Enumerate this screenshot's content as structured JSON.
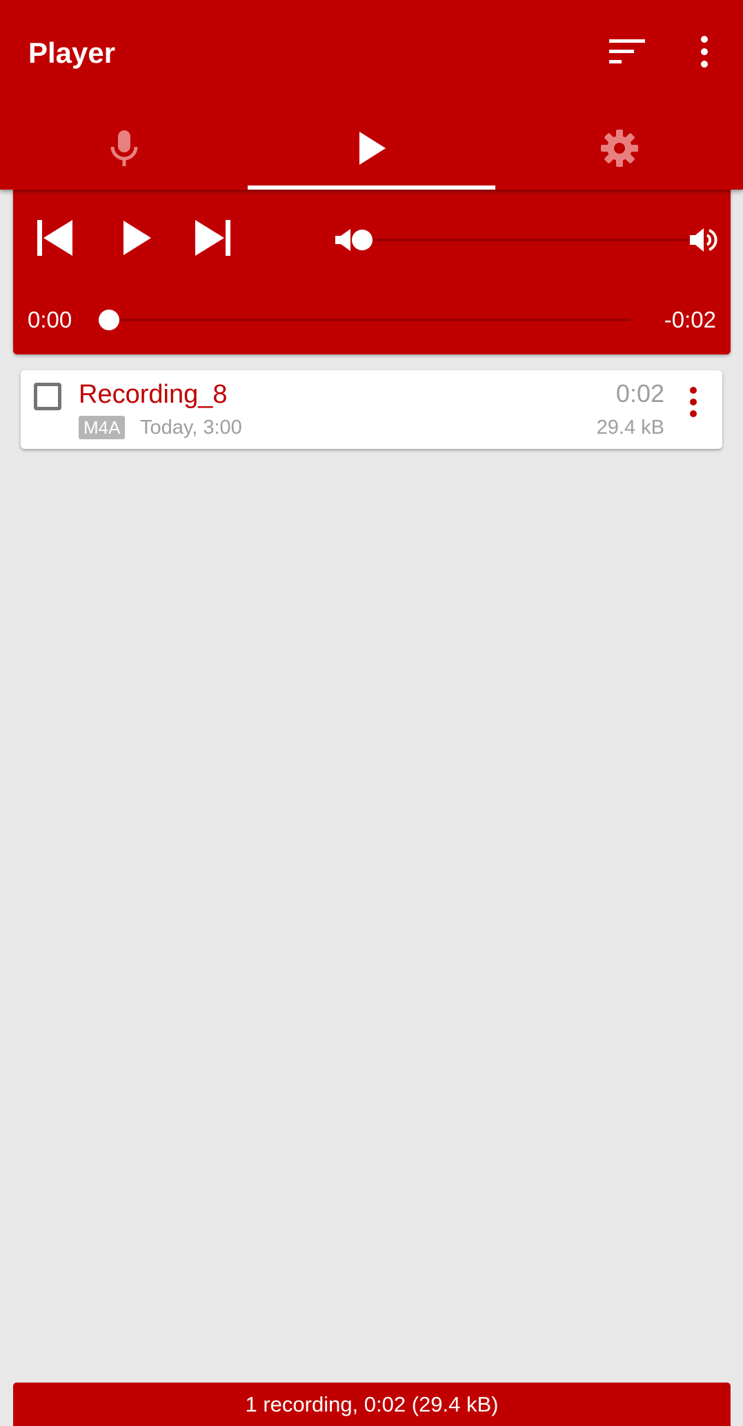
{
  "app_bar": {
    "title": "Player",
    "sort_icon": "sort-icon",
    "overflow_icon": "more-vert-icon"
  },
  "tabs": [
    {
      "name": "record",
      "icon": "mic-icon",
      "selected": false
    },
    {
      "name": "player",
      "icon": "play-icon",
      "selected": true
    },
    {
      "name": "settings",
      "icon": "gear-icon",
      "selected": false
    }
  ],
  "player": {
    "volume_fraction": 0.0,
    "position_fraction": 0.0,
    "elapsed": "0:00",
    "remaining": "-0:02"
  },
  "recordings": [
    {
      "name": "Recording_8",
      "format": "M4A",
      "date": "Today, 3:00",
      "duration": "0:02",
      "size": "29.4 kB",
      "checked": false
    }
  ],
  "status": {
    "summary": "1 recording, 0:02 (29.4 kB)"
  },
  "colors": {
    "primary": "#c00000",
    "track": "#9a0000",
    "background": "#e8e8e8",
    "muted_text": "#9e9e9e"
  }
}
